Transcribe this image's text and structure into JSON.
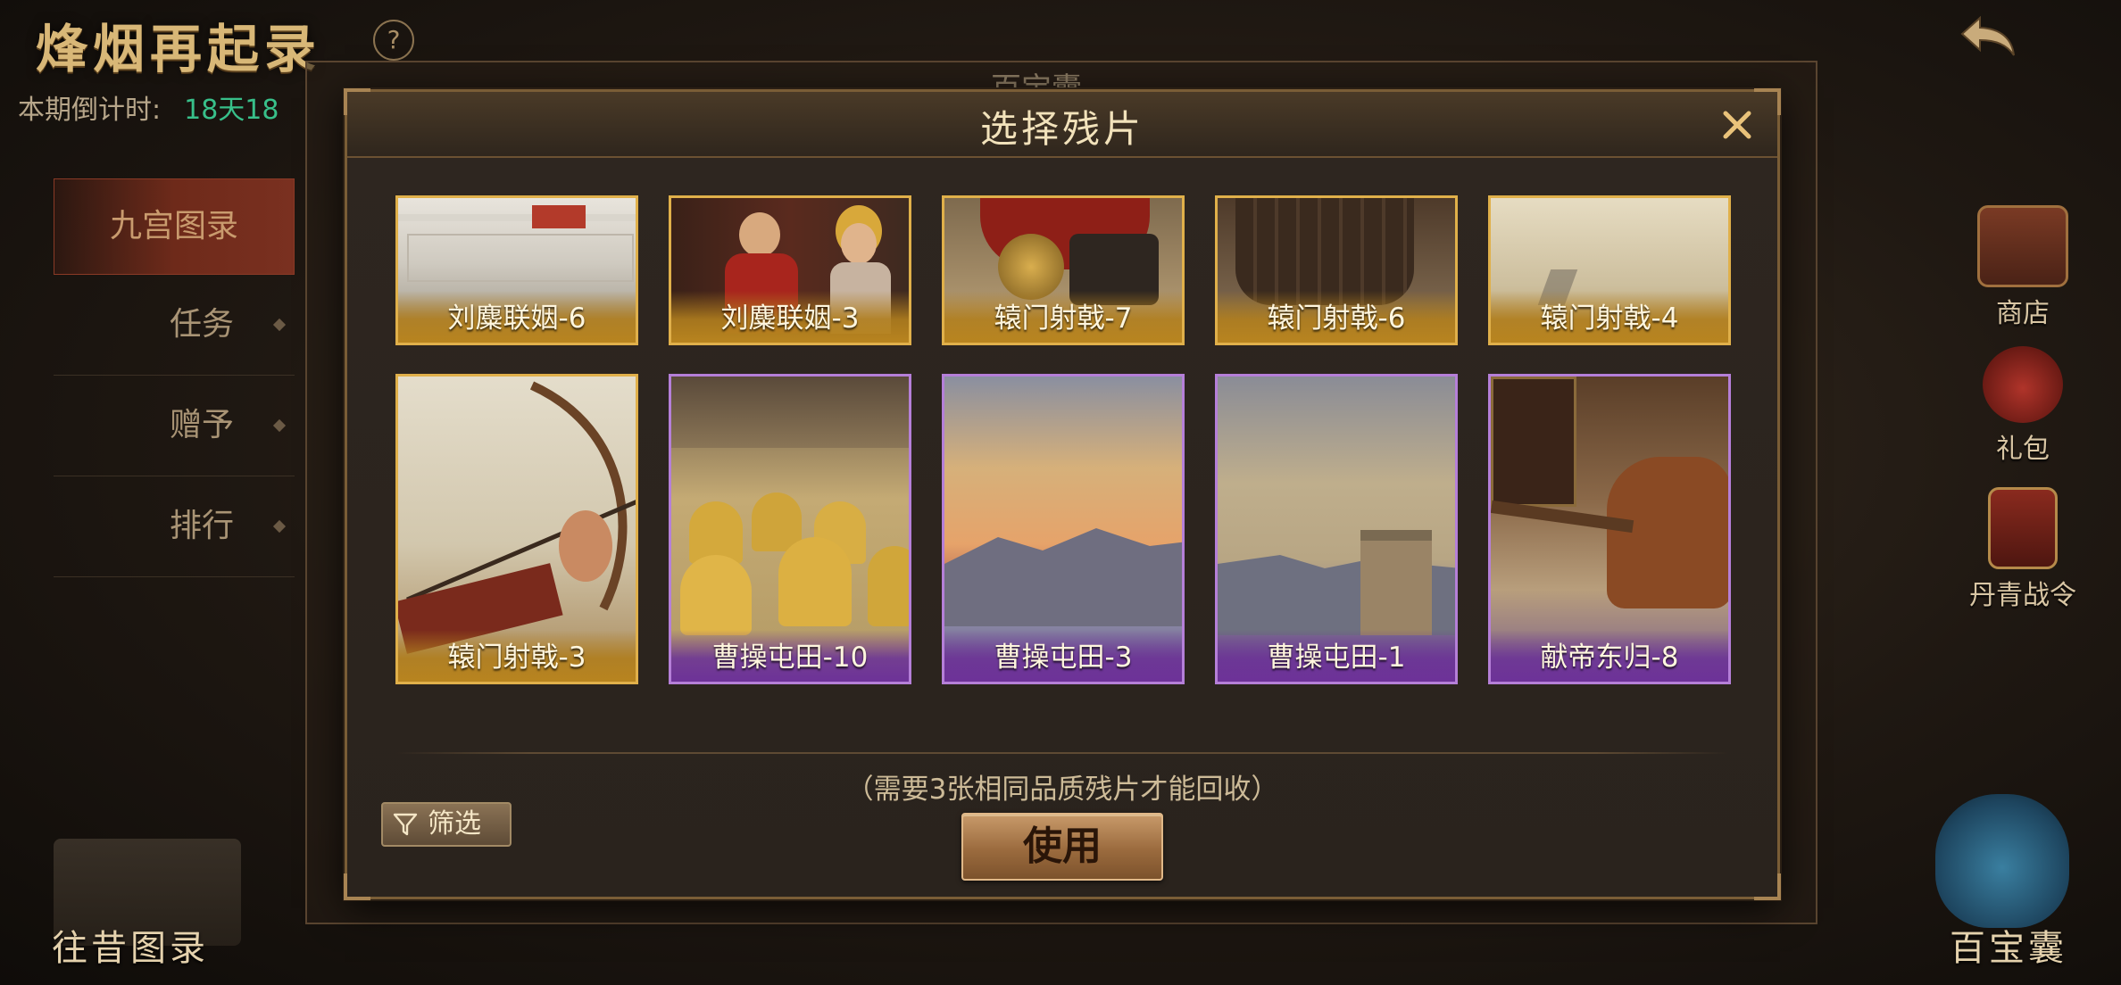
{
  "background": {
    "title": "烽烟再起录",
    "help": "?",
    "countdown_label": "本期倒计时:",
    "countdown_value": "18天18",
    "under_panel_title": "百宝囊",
    "side_tabs": [
      "九宫图录",
      "任务",
      "赠予",
      "排行"
    ],
    "right_menu": [
      {
        "label": "商店",
        "icon": "chest-icon"
      },
      {
        "label": "礼包",
        "icon": "gift-bag-icon"
      },
      {
        "label": "丹青战令",
        "icon": "war-order-icon"
      }
    ],
    "bottom_left": "往昔图录",
    "bottom_right": "百宝囊"
  },
  "modal": {
    "title": "选择残片",
    "cards": [
      {
        "label": "刘麋联姻-6",
        "quality": "gold",
        "art": "palace-railing"
      },
      {
        "label": "刘麋联姻-3",
        "quality": "gold",
        "art": "royal-couple"
      },
      {
        "label": "辕门射戟-7",
        "quality": "gold",
        "art": "armor-red"
      },
      {
        "label": "辕门射戟-6",
        "quality": "gold",
        "art": "armor-dark"
      },
      {
        "label": "辕门射戟-4",
        "quality": "gold",
        "art": "misty-sky"
      },
      {
        "label": "辕门射戟-3",
        "quality": "gold",
        "art": "archer-bow"
      },
      {
        "label": "曹操屯田-10",
        "quality": "purple",
        "art": "haystacks"
      },
      {
        "label": "曹操屯田-3",
        "quality": "purple",
        "art": "sunset-mountains"
      },
      {
        "label": "曹操屯田-1",
        "quality": "purple",
        "art": "watchtower"
      },
      {
        "label": "献帝东归-8",
        "quality": "purple",
        "art": "horse-carriage"
      }
    ],
    "hint": "（需要3张相同品质残片才能回收）",
    "filter_label": "筛选",
    "use_label": "使用"
  },
  "colors": {
    "gold_border": "#e0b04a",
    "purple_border": "#b57fd8",
    "title_text": "#f2e2bb",
    "countdown_value": "#38c08a"
  }
}
